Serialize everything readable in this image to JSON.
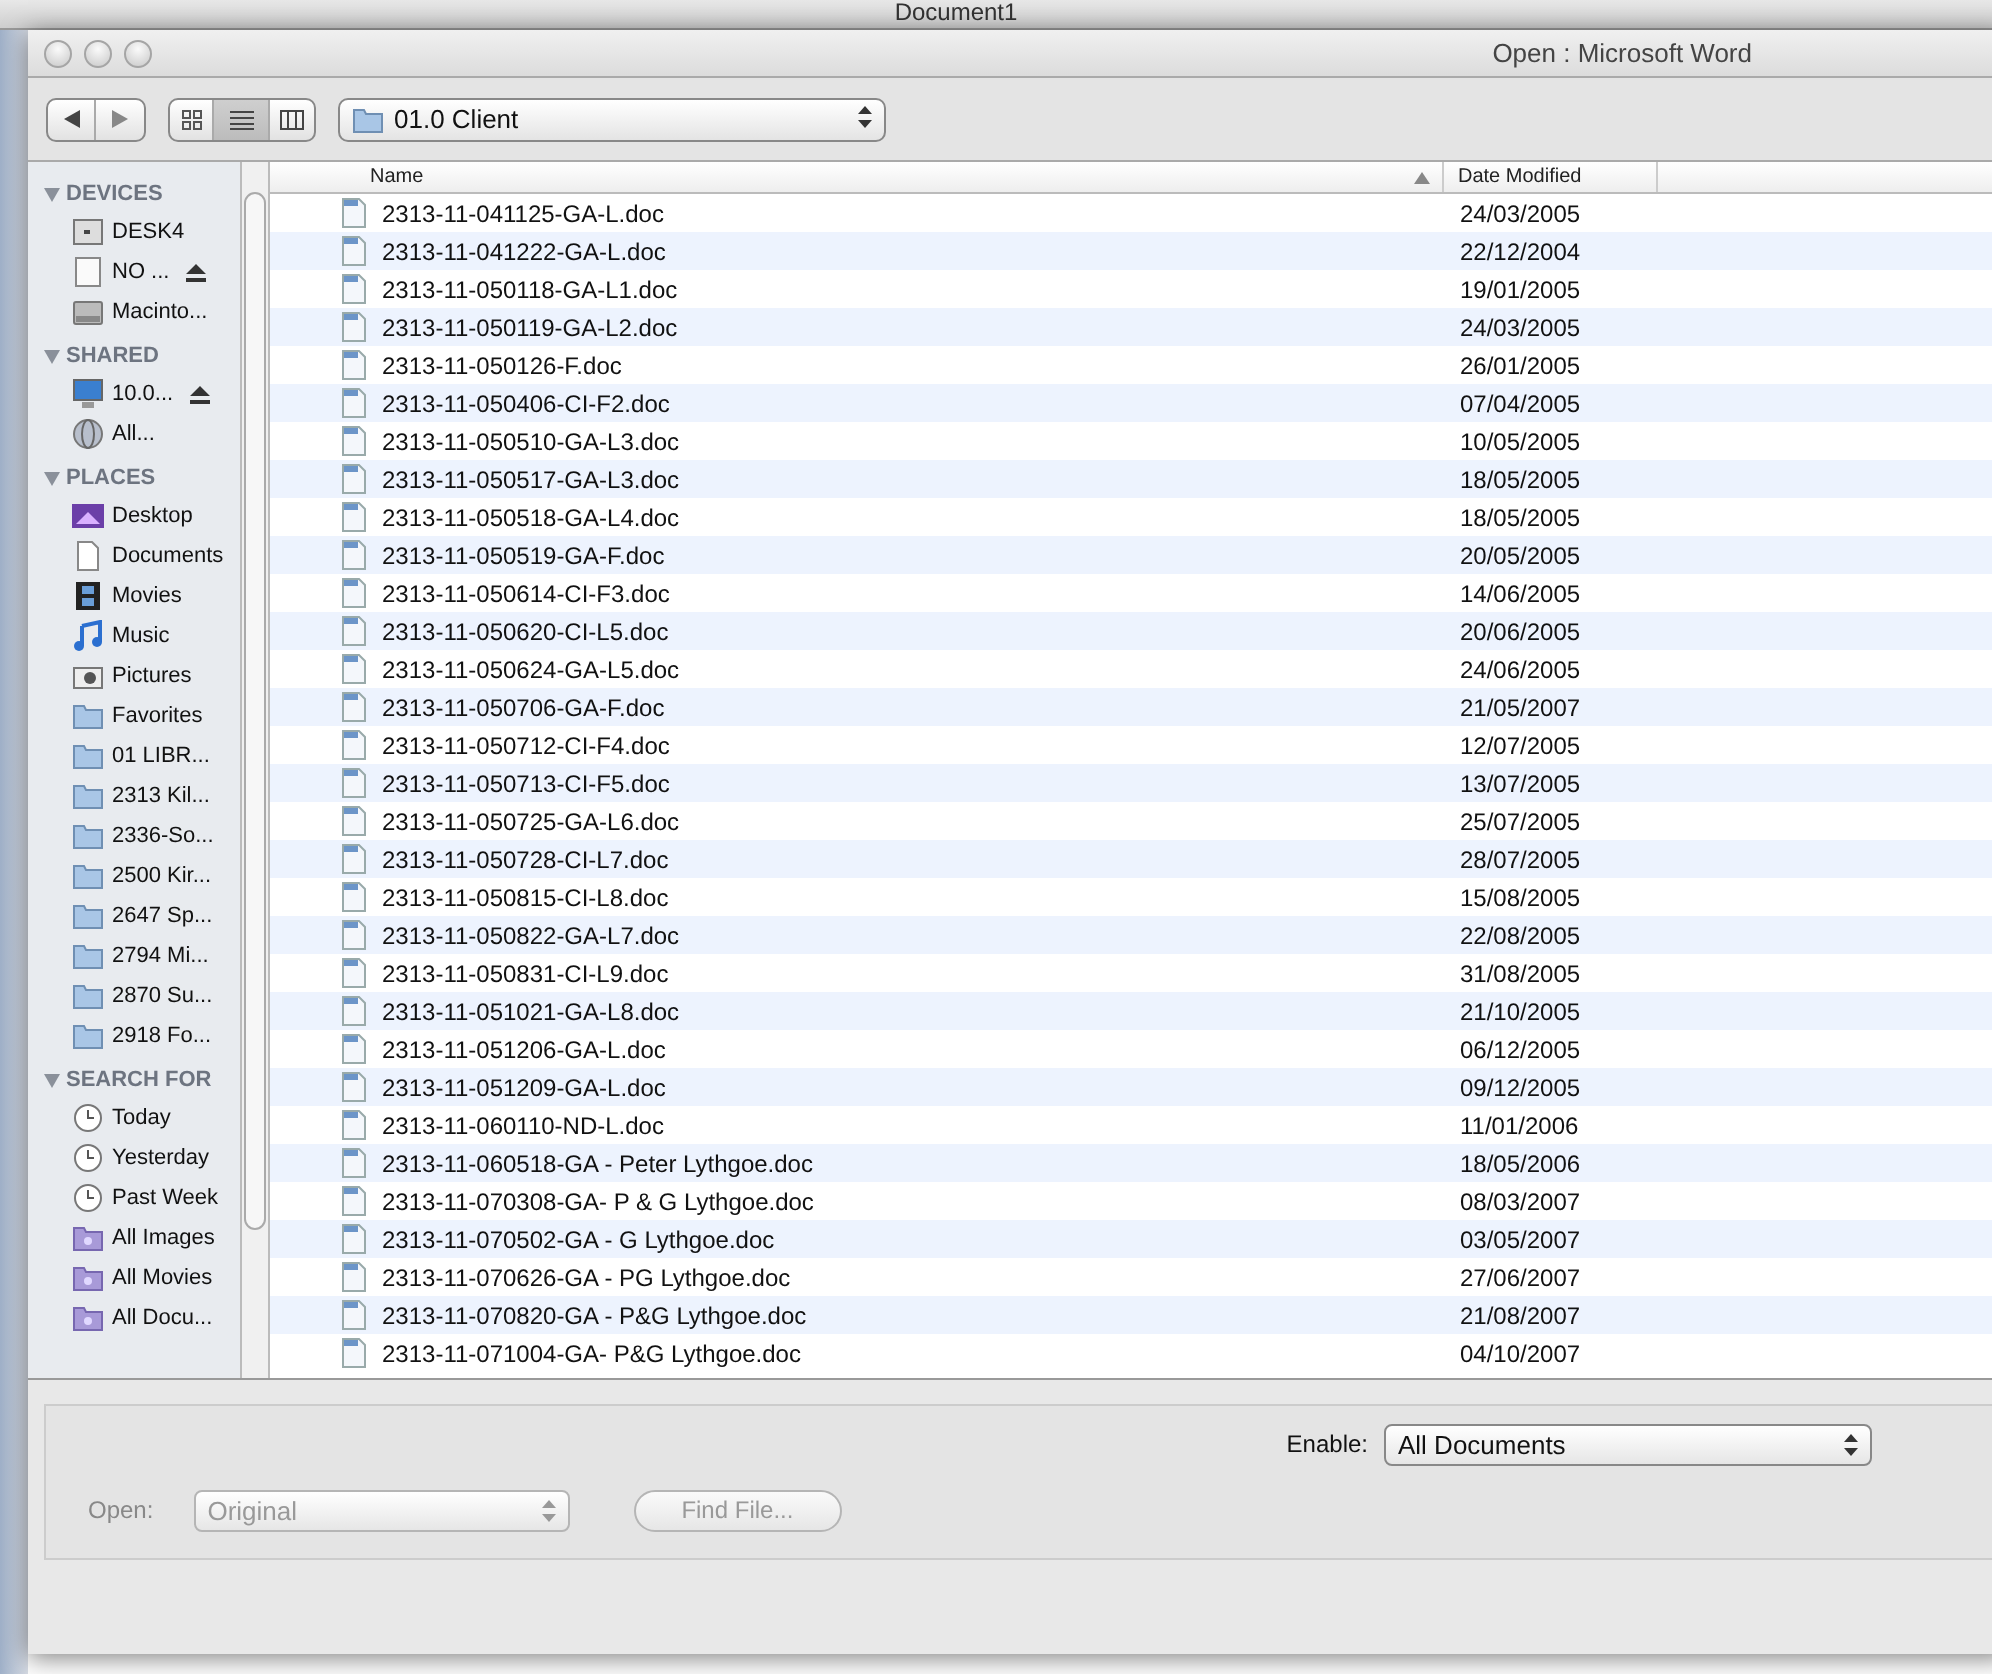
{
  "background_window": {
    "title": "Document1"
  },
  "window": {
    "title": "Open : Microsoft Word"
  },
  "toolbar": {
    "view_modes": [
      {
        "kind": "icons",
        "selected": false
      },
      {
        "kind": "list",
        "selected": true
      },
      {
        "kind": "columns",
        "selected": false
      }
    ],
    "location": "01.0 Client"
  },
  "sidebar": [
    {
      "heading": "DEVICES",
      "expanded": true,
      "items": [
        {
          "label": "DESK4",
          "kind": "server",
          "eject": false
        },
        {
          "label": "NO ...",
          "kind": "drive",
          "eject": true
        },
        {
          "label": "Macinto...",
          "kind": "harddisk",
          "eject": false
        }
      ]
    },
    {
      "heading": "SHARED",
      "expanded": true,
      "items": [
        {
          "label": "10.0...",
          "kind": "monitor",
          "eject": true
        },
        {
          "label": "All...",
          "kind": "globe",
          "eject": false
        }
      ]
    },
    {
      "heading": "PLACES",
      "expanded": true,
      "items": [
        {
          "label": "Desktop",
          "kind": "desktop",
          "eject": false
        },
        {
          "label": "Documents",
          "kind": "document",
          "eject": false
        },
        {
          "label": "Movies",
          "kind": "film",
          "eject": false
        },
        {
          "label": "Music",
          "kind": "music",
          "eject": false
        },
        {
          "label": "Pictures",
          "kind": "camera",
          "eject": false
        },
        {
          "label": "Favorites",
          "kind": "folder",
          "eject": false
        },
        {
          "label": "01 LIBR...",
          "kind": "folder",
          "eject": false
        },
        {
          "label": "2313 Kil...",
          "kind": "folder",
          "eject": false
        },
        {
          "label": "2336-So...",
          "kind": "folder",
          "eject": false
        },
        {
          "label": "2500 Kir...",
          "kind": "folder",
          "eject": false
        },
        {
          "label": "2647 Sp...",
          "kind": "folder",
          "eject": false
        },
        {
          "label": "2794 Mi...",
          "kind": "folder",
          "eject": false
        },
        {
          "label": "2870 Su...",
          "kind": "folder",
          "eject": false
        },
        {
          "label": "2918 Fo...",
          "kind": "folder",
          "eject": false
        }
      ]
    },
    {
      "heading": "SEARCH FOR",
      "expanded": true,
      "items": [
        {
          "label": "Today",
          "kind": "clock",
          "eject": false
        },
        {
          "label": "Yesterday",
          "kind": "clock",
          "eject": false
        },
        {
          "label": "Past Week",
          "kind": "clock",
          "eject": false
        },
        {
          "label": "All Images",
          "kind": "smartfolder",
          "eject": false
        },
        {
          "label": "All Movies",
          "kind": "smartfolder",
          "eject": false
        },
        {
          "label": "All Docu...",
          "kind": "smartfolder",
          "eject": false
        }
      ]
    }
  ],
  "file_list": {
    "columns": [
      "Name",
      "Date Modified"
    ],
    "rows": [
      {
        "name": "2313-11-041125-GA-L.doc",
        "date": "24/03/2005"
      },
      {
        "name": "2313-11-041222-GA-L.doc",
        "date": "22/12/2004"
      },
      {
        "name": "2313-11-050118-GA-L1.doc",
        "date": "19/01/2005"
      },
      {
        "name": "2313-11-050119-GA-L2.doc",
        "date": "24/03/2005"
      },
      {
        "name": "2313-11-050126-F.doc",
        "date": "26/01/2005"
      },
      {
        "name": "2313-11-050406-CI-F2.doc",
        "date": "07/04/2005"
      },
      {
        "name": "2313-11-050510-GA-L3.doc",
        "date": "10/05/2005"
      },
      {
        "name": "2313-11-050517-GA-L3.doc",
        "date": "18/05/2005"
      },
      {
        "name": "2313-11-050518-GA-L4.doc",
        "date": "18/05/2005"
      },
      {
        "name": "2313-11-050519-GA-F.doc",
        "date": "20/05/2005"
      },
      {
        "name": "2313-11-050614-CI-F3.doc",
        "date": "14/06/2005"
      },
      {
        "name": "2313-11-050620-CI-L5.doc",
        "date": "20/06/2005"
      },
      {
        "name": "2313-11-050624-GA-L5.doc",
        "date": "24/06/2005"
      },
      {
        "name": "2313-11-050706-GA-F.doc",
        "date": "21/05/2007"
      },
      {
        "name": "2313-11-050712-CI-F4.doc",
        "date": "12/07/2005"
      },
      {
        "name": "2313-11-050713-CI-F5.doc",
        "date": "13/07/2005"
      },
      {
        "name": "2313-11-050725-GA-L6.doc",
        "date": "25/07/2005"
      },
      {
        "name": "2313-11-050728-CI-L7.doc",
        "date": "28/07/2005"
      },
      {
        "name": "2313-11-050815-CI-L8.doc",
        "date": "15/08/2005"
      },
      {
        "name": "2313-11-050822-GA-L7.doc",
        "date": "22/08/2005"
      },
      {
        "name": "2313-11-050831-CI-L9.doc",
        "date": "31/08/2005"
      },
      {
        "name": "2313-11-051021-GA-L8.doc",
        "date": "21/10/2005"
      },
      {
        "name": "2313-11-051206-GA-L.doc",
        "date": "06/12/2005"
      },
      {
        "name": "2313-11-051209-GA-L.doc",
        "date": "09/12/2005"
      },
      {
        "name": "2313-11-060110-ND-L.doc",
        "date": "11/01/2006"
      },
      {
        "name": "2313-11-060518-GA - Peter Lythgoe.doc",
        "date": "18/05/2006"
      },
      {
        "name": "2313-11-070308-GA- P & G Lythgoe.doc",
        "date": "08/03/2007"
      },
      {
        "name": "2313-11-070502-GA - G Lythgoe.doc",
        "date": "03/05/2007"
      },
      {
        "name": "2313-11-070626-GA - PG Lythgoe.doc",
        "date": "27/06/2007"
      },
      {
        "name": "2313-11-070820-GA - P&G Lythgoe.doc",
        "date": "21/08/2007"
      },
      {
        "name": "2313-11-071004-GA- P&G Lythgoe.doc",
        "date": "04/10/2007"
      }
    ]
  },
  "options": {
    "enable_label": "Enable:",
    "enable_value": "All Documents",
    "open_label": "Open:",
    "open_value": "Original",
    "open_disabled": true,
    "find_button": "Find File...",
    "find_disabled": true
  }
}
